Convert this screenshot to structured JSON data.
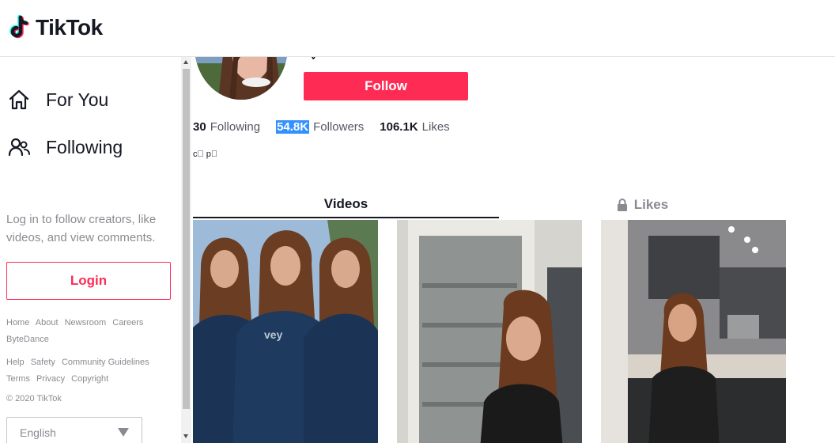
{
  "header": {
    "logo_text": "TikTok",
    "logo_icon": "tiktok-note-icon"
  },
  "sidebar": {
    "nav": [
      {
        "label": "For You",
        "icon": "home-icon"
      },
      {
        "label": "Following",
        "icon": "people-icon"
      }
    ],
    "login_hint": "Log in to follow creators, like videos, and view comments.",
    "login_label": "Login",
    "footer_row1": [
      "Home",
      "About",
      "Newsroom",
      "Careers",
      "ByteDance"
    ],
    "footer_row2": [
      "Help",
      "Safety",
      "Community Guidelines",
      "Terms",
      "Privacy",
      "Copyright"
    ],
    "copyright": "© 2020 TikTok",
    "language": "English"
  },
  "profile": {
    "follow_label": "Follow",
    "stats": [
      {
        "value": "30",
        "label": "Following"
      },
      {
        "value": "54.8K",
        "label": "Followers"
      },
      {
        "value": "106.1K",
        "label": "Likes"
      }
    ],
    "bio": "c\u0000 p\u0000"
  },
  "tabs": [
    {
      "label": "Videos",
      "active": true
    },
    {
      "label": "Likes",
      "locked": true,
      "icon": "lock-icon"
    }
  ],
  "colors": {
    "brand": "#fe2c55",
    "text": "#161823",
    "muted": "#8a8b91",
    "highlight": "#3390ff"
  }
}
